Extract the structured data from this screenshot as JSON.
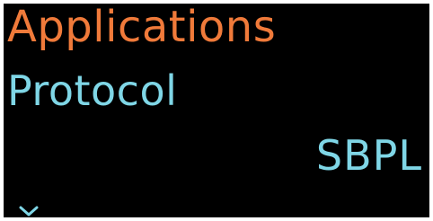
{
  "menu": {
    "title": "Applications"
  },
  "setting": {
    "label": "Protocol",
    "value": "SBPL"
  },
  "navigation": {
    "scroll_icon": "chevron-down-icon"
  },
  "colors": {
    "background": "#000000",
    "title": "#f07a3a",
    "text": "#7fd6e6"
  }
}
